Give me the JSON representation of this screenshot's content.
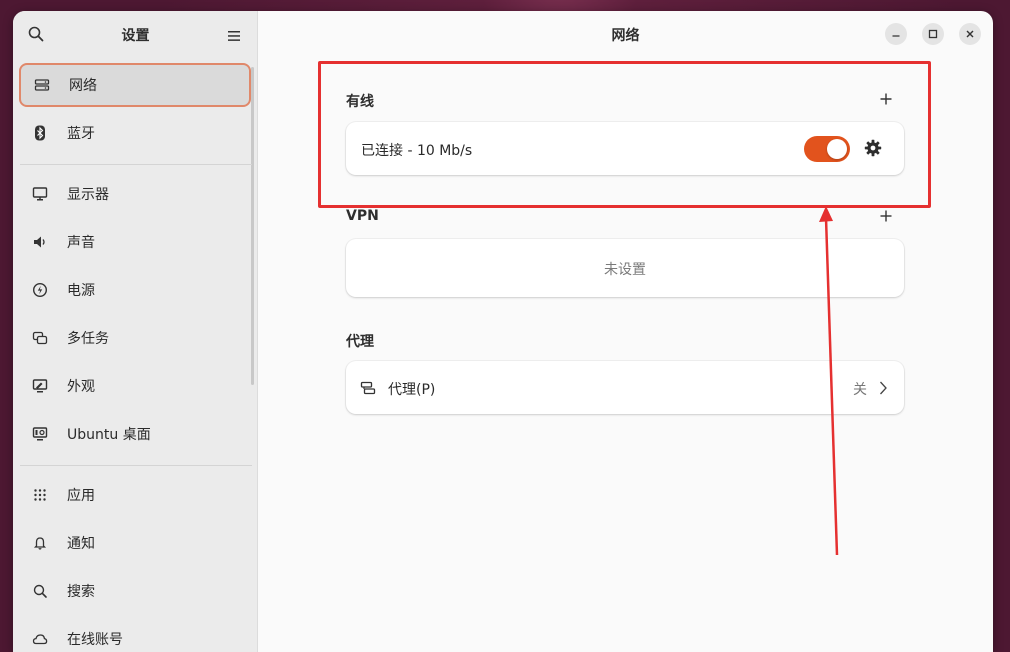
{
  "sidebar": {
    "title": "设置",
    "items": [
      {
        "label": "网络",
        "icon": "network-wired-icon",
        "active": true
      },
      {
        "label": "蓝牙",
        "icon": "bluetooth-icon"
      },
      {
        "label": "显示器",
        "icon": "display-icon"
      },
      {
        "label": "声音",
        "icon": "speaker-icon"
      },
      {
        "label": "电源",
        "icon": "power-icon"
      },
      {
        "label": "多任务",
        "icon": "multitasking-icon"
      },
      {
        "label": "外观",
        "icon": "appearance-icon"
      },
      {
        "label": "Ubuntu 桌面",
        "icon": "ubuntu-desktop-icon"
      },
      {
        "label": "应用",
        "icon": "apps-grid-icon"
      },
      {
        "label": "通知",
        "icon": "bell-icon"
      },
      {
        "label": "搜索",
        "icon": "search-icon"
      },
      {
        "label": "在线账号",
        "icon": "cloud-icon"
      }
    ]
  },
  "main": {
    "title": "网络",
    "wired": {
      "title": "有线",
      "status": "已连接 - 10 Mb/s",
      "toggle_on": true
    },
    "vpn": {
      "title": "VPN",
      "empty_text": "未设置"
    },
    "proxy": {
      "title": "代理",
      "label": "代理(P)",
      "value": "关"
    }
  },
  "colors": {
    "accent": "#e2531d",
    "highlight": "#e53030",
    "active_border": "#e0886a"
  }
}
